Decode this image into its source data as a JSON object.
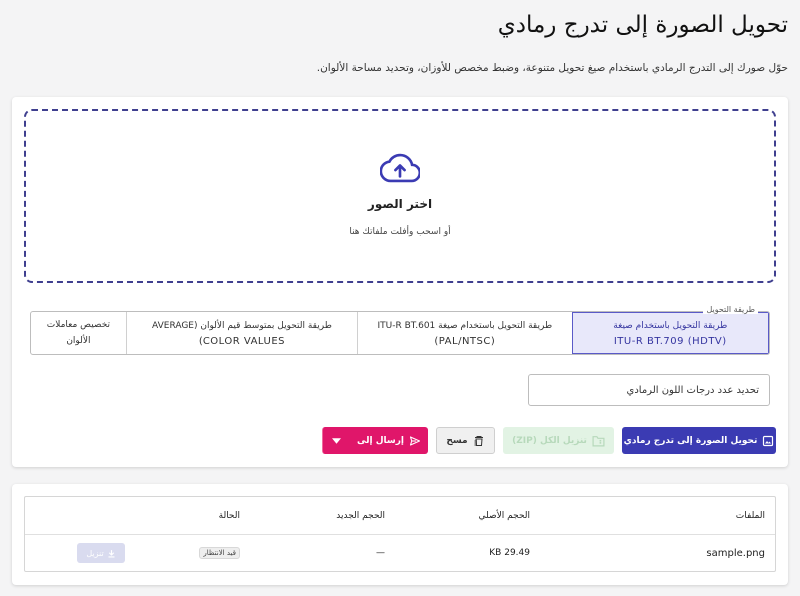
{
  "header": {
    "title": "تحويل الصورة إلى تدرج رمادي",
    "subtitle": "حوّل صورك إلى التدرج الرمادي باستخدام صيغ تحويل متنوعة، وضبط مخصص للأوزان، وتحديد مساحة الألوان."
  },
  "dropzone": {
    "icon": "cloud-upload-icon",
    "title": "اختر الصور",
    "subtitle": "أو اسحب وأفلت ملفاتك هنا"
  },
  "method": {
    "label": "طريقة التحويل",
    "options": [
      {
        "ar": "طريقة التحويل باستخدام صيغة",
        "en": "ITU-R BT.709 (HDTV)"
      },
      {
        "ar": "طريقة التحويل باستخدام صيغة ITU-R BT.601",
        "en": "(PAL/NTSC)"
      },
      {
        "ar": "طريقة التحويل بمتوسط قيم الألوان (AVERAGE",
        "en": "COLOR VALUES)"
      },
      {
        "ar": "تخصيص معاملات",
        "en": "الألوان"
      }
    ],
    "selected_index": 0
  },
  "gray_levels": {
    "label": "تحديد عدد درجات اللون الرمادي"
  },
  "toolbar": {
    "convert_label": "تحويل الصورة إلى تدرج رمادي",
    "zip_label": "تنزيل الكل (ZIP)",
    "clear_label": "مسح",
    "send_label": "إرسال إلى"
  },
  "table": {
    "headers": {
      "file": "الملفات",
      "original": "الحجم الأصلي",
      "new": "الحجم الجديد",
      "status": "الحالة"
    },
    "rows": [
      {
        "file": "sample.png",
        "original": "29.49 KB",
        "new": "—",
        "status": "قيد الانتظار",
        "action": "تنزيل"
      }
    ]
  },
  "colors": {
    "primary": "#3b3bb3",
    "accent": "#e0166a",
    "success_disabled": "#e2f3e4"
  }
}
